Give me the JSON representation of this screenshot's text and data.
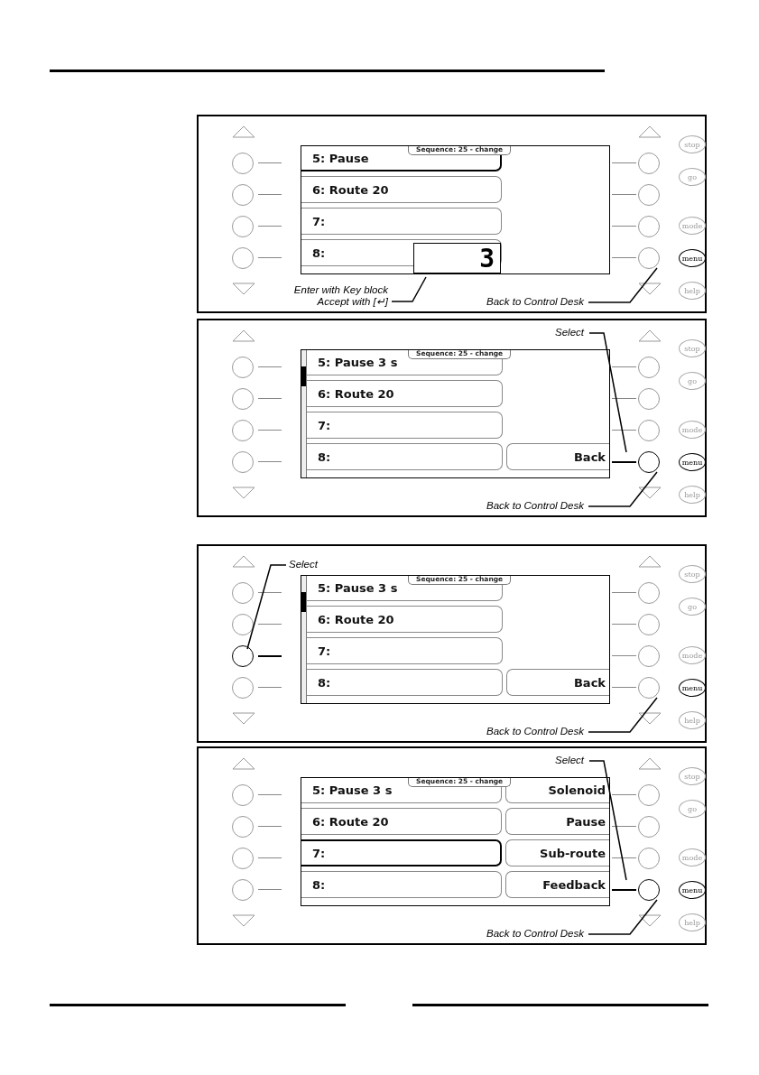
{
  "panels": [
    {
      "screen": {
        "title": "Sequence: 25 - change",
        "scrollbar": false,
        "input": {
          "value": "3"
        },
        "rows": [
          {
            "label": "5: Pause",
            "selected": true
          },
          {
            "label": "6: Route 20",
            "selected": false
          },
          {
            "label": "7:",
            "selected": false
          },
          {
            "label": "8:",
            "selected": false
          }
        ],
        "softkeys": [
          {
            "kind": "blank"
          },
          {
            "kind": "blank"
          },
          {
            "kind": "blank"
          },
          {
            "kind": "blank"
          }
        ]
      },
      "left_keys": [
        {
          "pressed": false
        },
        {
          "pressed": false
        },
        {
          "pressed": false
        },
        {
          "pressed": false
        }
      ],
      "right_keys": [
        {
          "pressed": false
        },
        {
          "pressed": false
        },
        {
          "pressed": false
        },
        {
          "pressed": false
        }
      ],
      "function_keys": [
        {
          "label": "stop",
          "active": false
        },
        {
          "label": "go",
          "active": false
        },
        {
          "label": "mode",
          "active": false
        },
        {
          "label": "menu",
          "active": true
        },
        {
          "label": "help",
          "active": false
        }
      ],
      "callouts": [
        {
          "kind": "enter",
          "lines": [
            "Enter with Key block",
            "Accept with [↵]"
          ]
        },
        {
          "kind": "back",
          "lines": [
            "Back to Control Desk"
          ]
        }
      ]
    },
    {
      "screen": {
        "title": "Sequence: 25 - change",
        "scrollbar": true,
        "rows": [
          {
            "label": "5: Pause 3 s",
            "selected": false
          },
          {
            "label": "6: Route 20",
            "selected": false
          },
          {
            "label": "7:",
            "selected": false
          },
          {
            "label": "8:",
            "selected": false
          }
        ],
        "softkeys": [
          {
            "kind": "blank"
          },
          {
            "kind": "blank"
          },
          {
            "kind": "blank"
          },
          {
            "kind": "softkey",
            "label": "Back"
          }
        ]
      },
      "left_keys": [
        {
          "pressed": false
        },
        {
          "pressed": false
        },
        {
          "pressed": false
        },
        {
          "pressed": false
        }
      ],
      "right_keys": [
        {
          "pressed": false
        },
        {
          "pressed": false
        },
        {
          "pressed": false
        },
        {
          "pressed": true
        }
      ],
      "function_keys": [
        {
          "label": "stop",
          "active": false
        },
        {
          "label": "go",
          "active": false
        },
        {
          "label": "mode",
          "active": false
        },
        {
          "label": "menu",
          "active": true
        },
        {
          "label": "help",
          "active": false
        }
      ],
      "callouts": [
        {
          "kind": "select_right",
          "lines": [
            "Select"
          ]
        },
        {
          "kind": "back",
          "lines": [
            "Back to Control Desk"
          ]
        }
      ]
    },
    {
      "screen": {
        "title": "Sequence: 25 - change",
        "scrollbar": true,
        "rows": [
          {
            "label": "5: Pause 3 s",
            "selected": false
          },
          {
            "label": "6: Route 20",
            "selected": false
          },
          {
            "label": "7:",
            "selected": false
          },
          {
            "label": "8:",
            "selected": false
          }
        ],
        "softkeys": [
          {
            "kind": "blank"
          },
          {
            "kind": "blank"
          },
          {
            "kind": "blank"
          },
          {
            "kind": "softkey",
            "label": "Back"
          }
        ]
      },
      "left_keys": [
        {
          "pressed": false
        },
        {
          "pressed": false
        },
        {
          "pressed": true
        },
        {
          "pressed": false
        }
      ],
      "right_keys": [
        {
          "pressed": false
        },
        {
          "pressed": false
        },
        {
          "pressed": false
        },
        {
          "pressed": false
        }
      ],
      "function_keys": [
        {
          "label": "stop",
          "active": false
        },
        {
          "label": "go",
          "active": false
        },
        {
          "label": "mode",
          "active": false
        },
        {
          "label": "menu",
          "active": true
        },
        {
          "label": "help",
          "active": false
        }
      ],
      "callouts": [
        {
          "kind": "select_left",
          "lines": [
            "Select"
          ]
        },
        {
          "kind": "back",
          "lines": [
            "Back to Control Desk"
          ]
        }
      ]
    },
    {
      "screen": {
        "title": "Sequence: 25 - change",
        "scrollbar": false,
        "rows": [
          {
            "label": "5: Pause 3 s",
            "selected": false
          },
          {
            "label": "6: Route 20",
            "selected": false
          },
          {
            "label": "7:",
            "selected": true
          },
          {
            "label": "8:",
            "selected": false
          }
        ],
        "softkeys": [
          {
            "kind": "softkey",
            "label": "Solenoid"
          },
          {
            "kind": "softkey",
            "label": "Pause"
          },
          {
            "kind": "softkey",
            "label": "Sub-route"
          },
          {
            "kind": "softkey",
            "label": "Feedback"
          }
        ]
      },
      "left_keys": [
        {
          "pressed": false
        },
        {
          "pressed": false
        },
        {
          "pressed": false
        },
        {
          "pressed": false
        }
      ],
      "right_keys": [
        {
          "pressed": false
        },
        {
          "pressed": false
        },
        {
          "pressed": false
        },
        {
          "pressed": true
        }
      ],
      "function_keys": [
        {
          "label": "stop",
          "active": false
        },
        {
          "label": "go",
          "active": false
        },
        {
          "label": "mode",
          "active": false
        },
        {
          "label": "menu",
          "active": true
        },
        {
          "label": "help",
          "active": false
        }
      ],
      "callouts": [
        {
          "kind": "select_right",
          "lines": [
            "Select"
          ]
        },
        {
          "kind": "back",
          "lines": [
            "Back to Control Desk"
          ]
        }
      ]
    }
  ]
}
